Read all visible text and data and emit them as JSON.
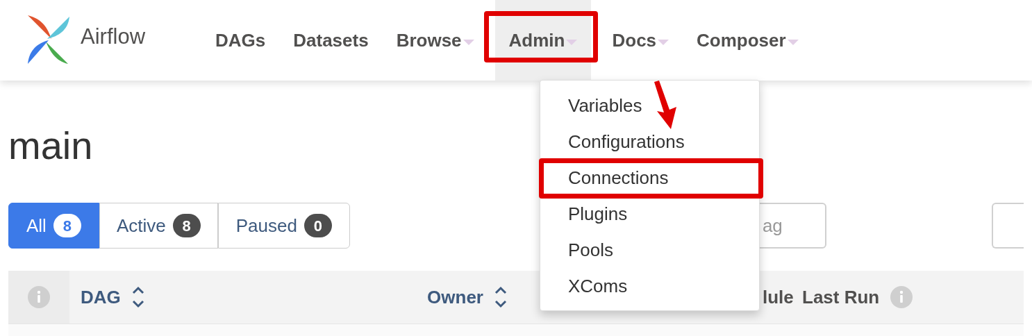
{
  "brand": {
    "name": "Airflow"
  },
  "nav": [
    {
      "label": "DAGs",
      "caret": false,
      "selected": false,
      "highlighted": false
    },
    {
      "label": "Datasets",
      "caret": false,
      "selected": false,
      "highlighted": false
    },
    {
      "label": "Browse",
      "caret": true,
      "selected": false,
      "highlighted": false
    },
    {
      "label": "Admin",
      "caret": true,
      "selected": true,
      "highlighted": true
    },
    {
      "label": "Docs",
      "caret": true,
      "selected": false,
      "highlighted": false
    },
    {
      "label": "Composer",
      "caret": true,
      "selected": false,
      "highlighted": false
    }
  ],
  "dropdown": {
    "items": [
      {
        "label": "Variables",
        "highlighted": false
      },
      {
        "label": "Configurations",
        "highlighted": false
      },
      {
        "label": "Connections",
        "highlighted": true
      },
      {
        "label": "Plugins",
        "highlighted": false
      },
      {
        "label": "Pools",
        "highlighted": false
      },
      {
        "label": "XComs",
        "highlighted": false
      }
    ]
  },
  "page": {
    "title": "main"
  },
  "filters": [
    {
      "label": "All",
      "count": "8",
      "selected": true
    },
    {
      "label": "Active",
      "count": "8",
      "selected": false
    },
    {
      "label": "Paused",
      "count": "0",
      "selected": false
    }
  ],
  "tag_search": {
    "placeholder": "ag"
  },
  "table": {
    "columns": [
      {
        "label": "DAG",
        "sortable": true,
        "info": false
      },
      {
        "label": "Owner",
        "sortable": true,
        "info": false
      },
      {
        "label": "lule",
        "sortable": false,
        "info": false
      },
      {
        "label": "Last Run",
        "sortable": false,
        "info": true
      }
    ]
  }
}
